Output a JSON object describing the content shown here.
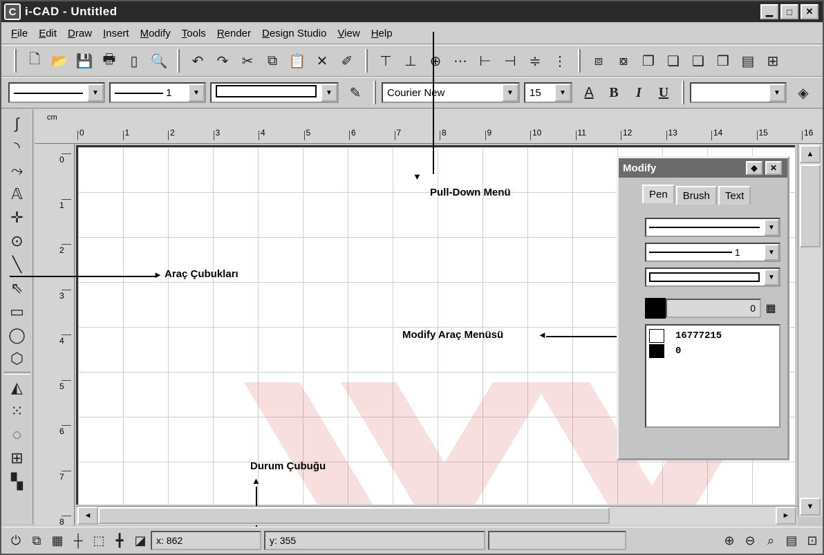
{
  "app": {
    "title": "i-CAD - Untitled",
    "icon": "icad-logo-icon"
  },
  "window_buttons": [
    "minimize-icon",
    "maximize-icon",
    "close-icon"
  ],
  "menu": [
    "File",
    "Edit",
    "Draw",
    "Insert",
    "Modify",
    "Tools",
    "Render",
    "Design Studio",
    "View",
    "Help"
  ],
  "toolbar1": {
    "icons": [
      "new-icon",
      "open-icon",
      "save-icon",
      "print-icon",
      "page-icon",
      "print-preview-icon",
      "undo-icon",
      "redo-icon",
      "cut-icon",
      "copy-icon",
      "paste-icon",
      "delete-icon",
      "clear-icon",
      "align-top-icon",
      "align-bottom-icon",
      "align-center-icon",
      "distribute-icon",
      "align-left-icon",
      "align-right-icon",
      "align-middle-icon",
      "align-vertical-icon",
      "group-icon",
      "ungroup-icon",
      "bring-front-icon",
      "send-back-icon",
      "bring-forward-icon",
      "send-backward-icon",
      "properties-icon",
      "fullscreen-icon"
    ]
  },
  "toolbar2": {
    "line_style": "",
    "line_width": "1",
    "fill_style": "",
    "font": "Courier New",
    "font_size": "15",
    "bold": "B",
    "italic": "I",
    "underline": "U"
  },
  "toolbox": [
    "curve-icon",
    "arc-icon",
    "bezier-icon",
    "text-tool-icon",
    "point-icon",
    "circle-point-icon",
    "line-icon",
    "select-arrow-icon",
    "rectangle-icon",
    "ellipse-icon",
    "polygon-icon",
    "mirror-icon",
    "grid-pattern-icon",
    "dotted-circle-icon",
    "table-icon",
    "fill-icon"
  ],
  "ruler": {
    "unit": "cm",
    "h_labels": [
      "0",
      "1",
      "2",
      "3",
      "4",
      "5",
      "6",
      "7",
      "8",
      "9",
      "10",
      "11",
      "12",
      "13",
      "14",
      "15",
      "16"
    ],
    "v_labels": [
      "0",
      "1",
      "2",
      "3",
      "4",
      "5",
      "6",
      "7",
      "8"
    ]
  },
  "annotations": {
    "pulldown": "Pull-Down Menü",
    "toolbars": "Araç Çubukları",
    "modify_menu": "Modify Araç Menüsü",
    "status_bar": "Durum Çubuğu"
  },
  "modify_panel": {
    "title": "Modify",
    "tabs": [
      "Pen",
      "Brush",
      "Text"
    ],
    "pen_width": "1",
    "color_value": "0",
    "colors": [
      {
        "value": "16777215",
        "color": "#ffffff"
      },
      {
        "value": "0",
        "color": "#000000"
      }
    ]
  },
  "status": {
    "x": "x: 862",
    "y": "y: 355",
    "icons": [
      "snap-icon",
      "grid-icon",
      "crosshair-icon",
      "ortho-icon",
      "cursor-icon",
      "layer-icon"
    ],
    "zoom_icons": [
      "zoom-in-icon",
      "zoom-out-icon",
      "zoom-window-icon",
      "zoom-all-icon",
      "zoom-extents-icon"
    ]
  }
}
